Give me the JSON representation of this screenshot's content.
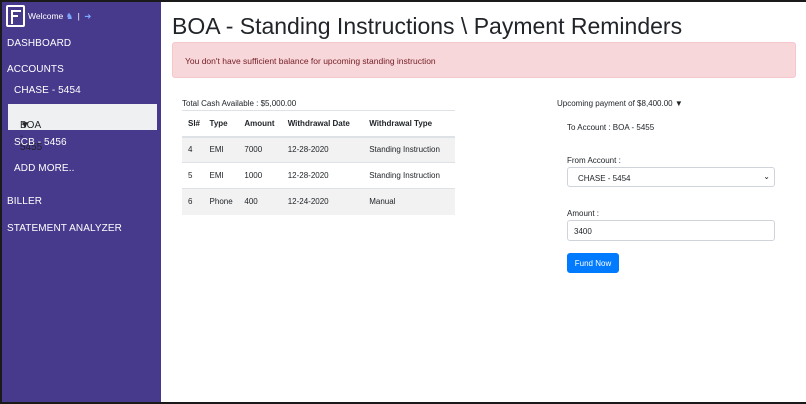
{
  "sidebar": {
    "welcome": "Welcome",
    "welcome_sep": "|",
    "user_icon": "user-icon",
    "logout_icon": "sign-out-icon",
    "items": [
      {
        "label": "DASHBOARD"
      },
      {
        "label": "ACCOUNTS"
      },
      {
        "label": "CHASE - 5454"
      },
      {
        "label": "BOA - 5455",
        "icon": "thumbs-down-icon"
      },
      {
        "label": "SCB - 5456"
      },
      {
        "label": "ADD MORE.."
      },
      {
        "label": "BILLER"
      },
      {
        "label": "STATEMENT ANALYZER"
      }
    ]
  },
  "main": {
    "title": "BOA - Standing Instructions \\ Payment Reminders",
    "alert": "You don't have sufficient balance for upcoming standing instruction",
    "cash_available": "Total Cash Available : $5,000.00",
    "table": {
      "headers": [
        "Sl#",
        "Type",
        "Amount",
        "Withdrawal Date",
        "Withdrawal Type"
      ],
      "rows": [
        [
          "4",
          "EMI",
          "7000",
          "12-28-2020",
          "Standing Instruction"
        ],
        [
          "5",
          "EMI",
          "1000",
          "12-28-2020",
          "Standing Instruction"
        ],
        [
          "6",
          "Phone",
          "400",
          "12-24-2020",
          "Manual"
        ]
      ]
    },
    "payment": {
      "upcoming": "Upcoming payment of $8,400.00",
      "to_account": "To Account : BOA - 5455",
      "from_label": "From Account :",
      "from_value": "CHASE - 5454",
      "amount_label": "Amount :",
      "amount_value": "3400",
      "button": "Fund Now"
    }
  },
  "colors": {
    "sidebar_bg": "#473a8c",
    "alert_bg": "#f8d7da",
    "alert_text": "#721c24",
    "primary": "#007bff"
  }
}
